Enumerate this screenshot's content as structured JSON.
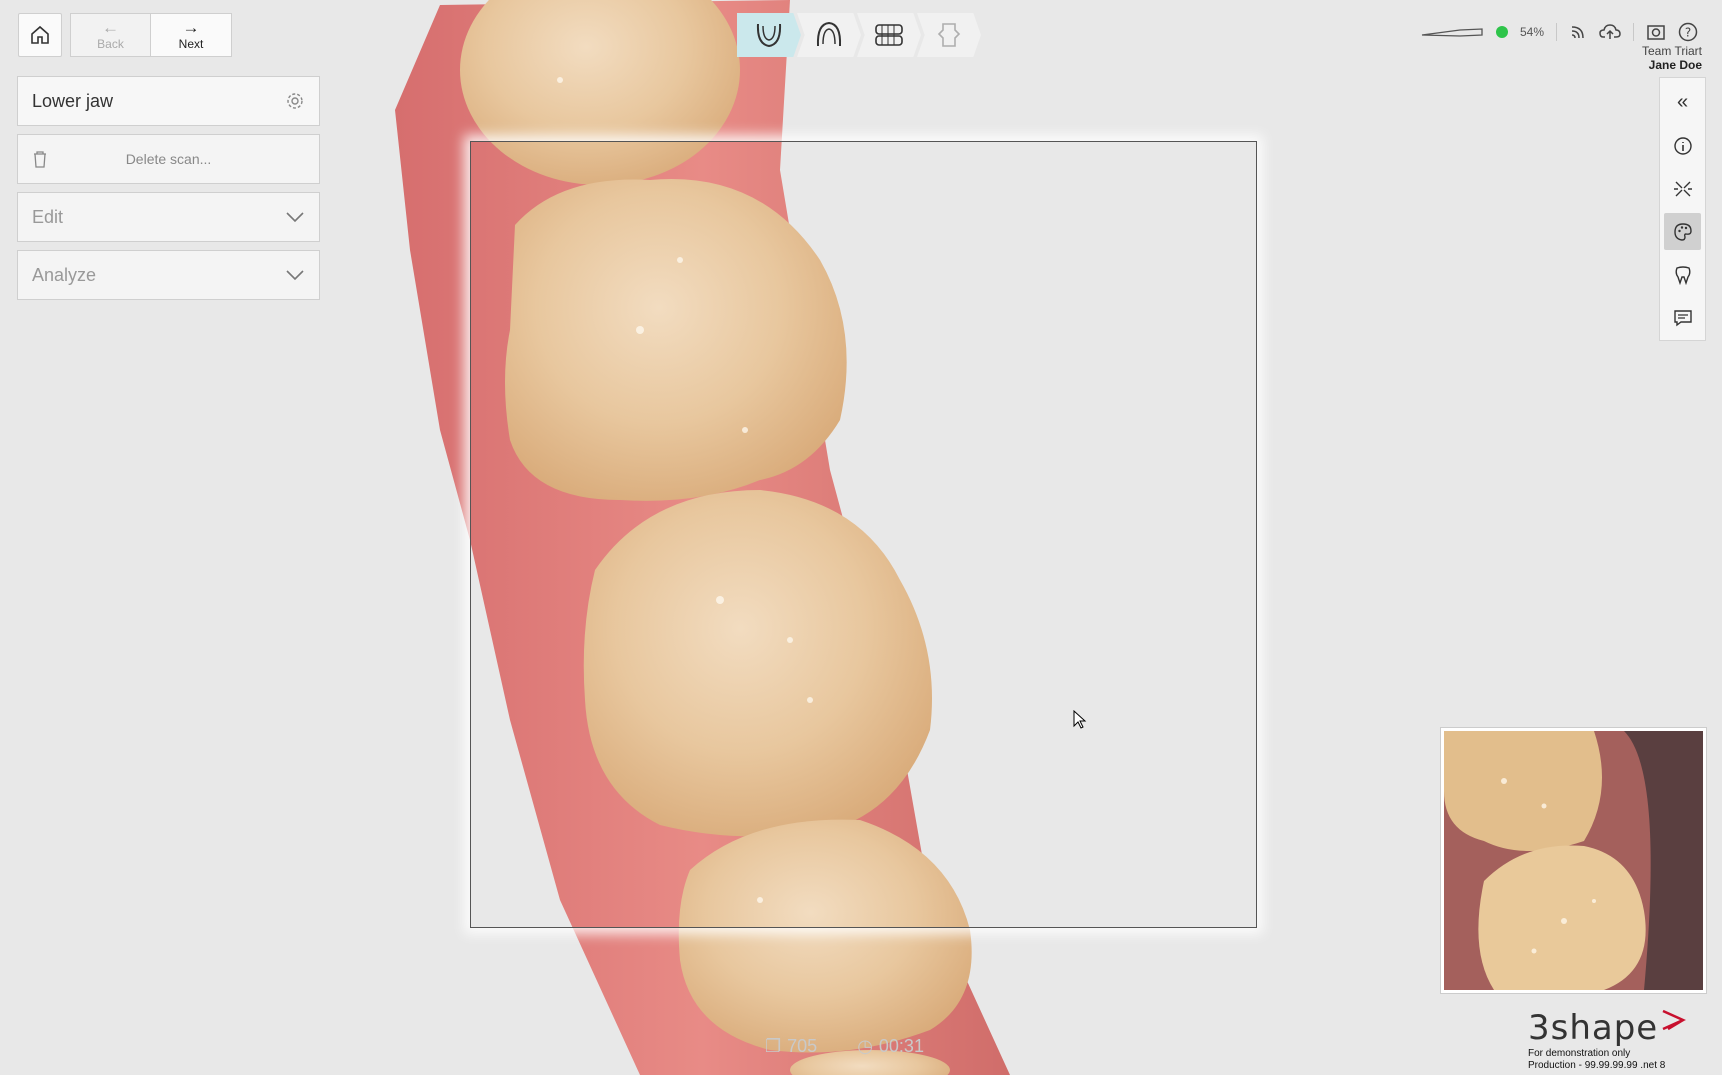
{
  "nav": {
    "back_label": "Back",
    "next_label": "Next"
  },
  "left_panel": {
    "jaw_label": "Lower jaw",
    "delete_label": "Delete scan...",
    "edit_label": "Edit",
    "analyze_label": "Analyze"
  },
  "workflow_steps": [
    "lower-jaw-icon",
    "upper-jaw-icon",
    "bite-icon",
    "scan-body-icon"
  ],
  "status": {
    "battery": "54%",
    "connection_color": "#2ec44a",
    "team": "Team Triart",
    "user": "Jane Doe"
  },
  "right_toolbar": [
    "collapse-icon",
    "info-icon",
    "trim-icon",
    "color-palette-icon",
    "tooth-icon",
    "comment-icon"
  ],
  "counters": {
    "images": "705",
    "time": "00:31"
  },
  "brand": {
    "logo": "3shape",
    "demo_line1": "For demonstration only",
    "demo_line2": "Production - 99.99.99.99 .net 8",
    "accent": "#c8102e"
  }
}
